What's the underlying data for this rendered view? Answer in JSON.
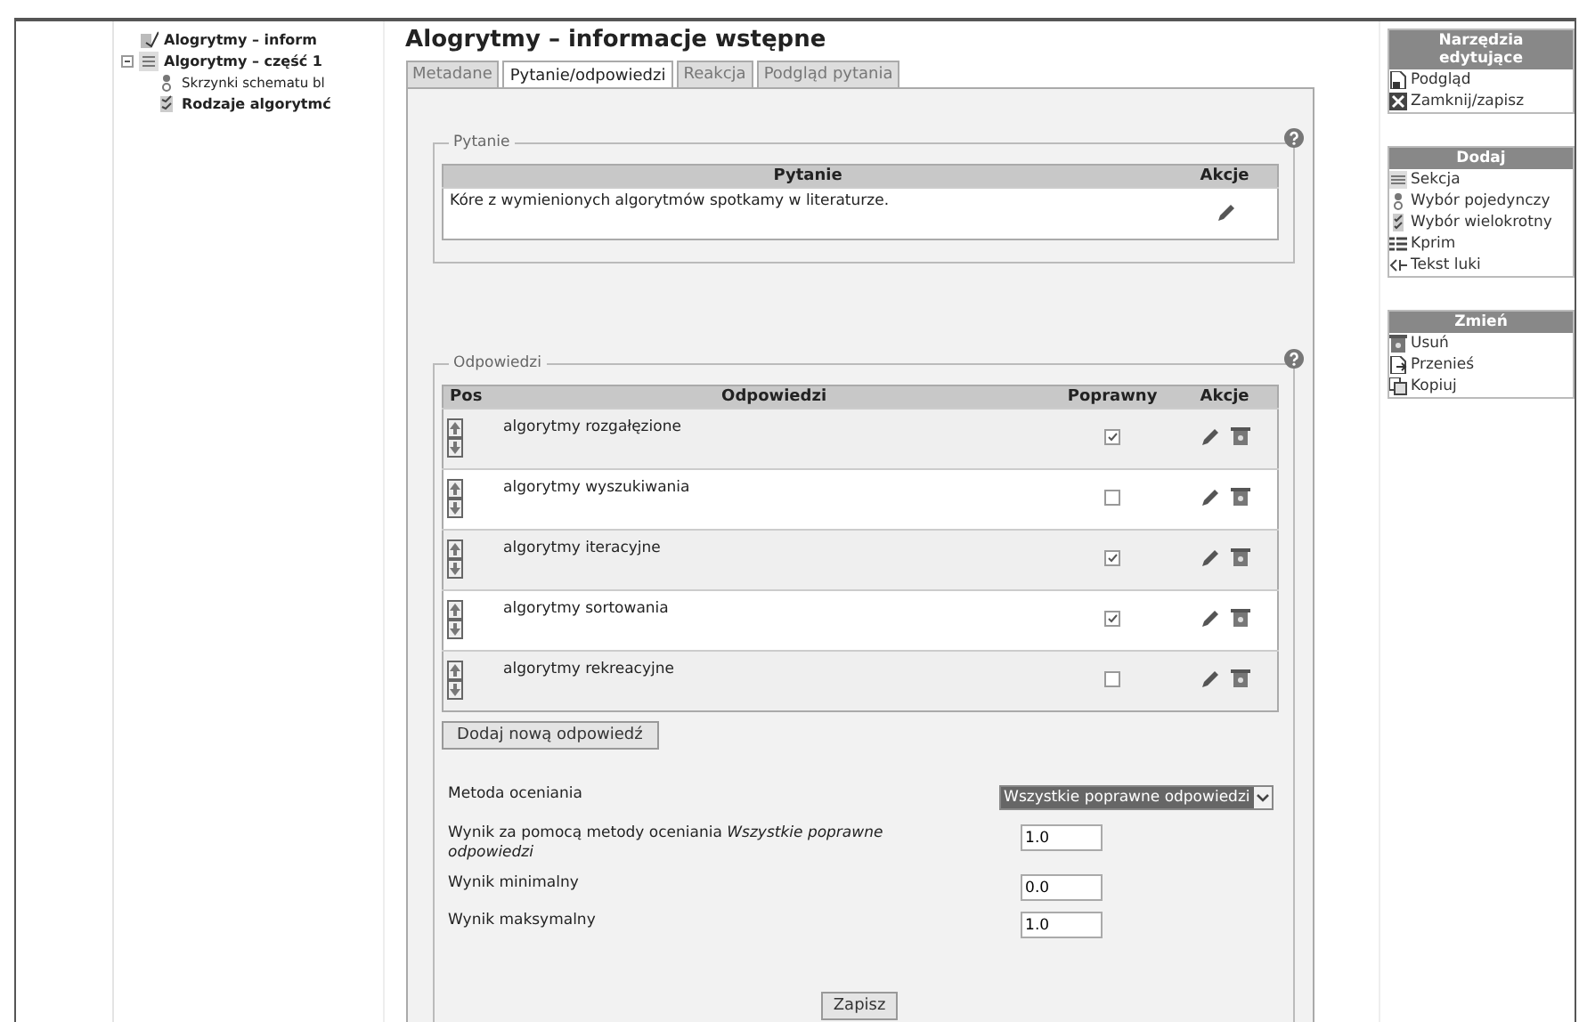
{
  "tree": [
    {
      "label": "Alogrytmy – inform",
      "kind": "quiz"
    },
    {
      "label": "Algorytmy – część 1",
      "kind": "section",
      "expanded": true,
      "children": [
        {
          "label": "Skrzynki schematu bl",
          "kind": "single",
          "selected": false
        },
        {
          "label": "Rodzaje algorytmć",
          "kind": "multiple",
          "selected": true
        }
      ]
    }
  ],
  "title": "Alogrytmy – informacje wstępne",
  "tabs": [
    {
      "label": "Metadane",
      "selected": false
    },
    {
      "label": "Pytanie/odpowiedzi",
      "selected": true
    },
    {
      "label": "Reakcja",
      "selected": false
    },
    {
      "label": "Podgląd pytania",
      "selected": false
    }
  ],
  "question": {
    "legend": "Pytanie",
    "columns": [
      "Pytanie",
      "Akcje"
    ],
    "text": "Kóre z wymienionych algorytmów spotkamy w literaturze."
  },
  "answers": {
    "legend": "Odpowiedzi",
    "columns": [
      "Pos",
      "Odpowiedzi",
      "Poprawny",
      "Akcje"
    ],
    "rows": [
      {
        "text": "algorytmy rozgałęzione",
        "correct": true
      },
      {
        "text": "algorytmy wyszukiwania",
        "correct": false
      },
      {
        "text": "algorytmy iteracyjne",
        "correct": true
      },
      {
        "text": "algorytmy sortowania",
        "correct": true
      },
      {
        "text": "algorytmy rekreacyjne",
        "correct": false
      }
    ],
    "add_button": "Dodaj nową odpowiedź"
  },
  "grading": {
    "method_label": "Metoda oceniania",
    "method_value": "Wszystkie poprawne odpowiedzi",
    "fields": [
      {
        "label": "Wynik za pomocą metody oceniania *Wszystkie poprawne odpowiedzi*",
        "value": "1.0"
      },
      {
        "label": "Wynik minimalny",
        "value": "0.0"
      },
      {
        "label": "Wynik maksymalny",
        "value": "1.0"
      }
    ]
  },
  "save_button": "Zapisz",
  "side_panels": [
    {
      "title": "Narzędzia edytujące",
      "items": [
        {
          "label": "Podgląd",
          "kind": "preview"
        },
        {
          "label": "Zamknij/zapisz",
          "kind": "close"
        }
      ]
    },
    {
      "title": "Dodaj",
      "items": [
        {
          "label": "Sekcja",
          "kind": "section"
        },
        {
          "label": "Wybór pojedynczy",
          "kind": "single"
        },
        {
          "label": "Wybór wielokrotny",
          "kind": "multiple"
        },
        {
          "label": "Kprim",
          "kind": "kprim"
        },
        {
          "label": "Tekst luki",
          "kind": "gap"
        }
      ]
    },
    {
      "title": "Zmień",
      "items": [
        {
          "label": "Usuń",
          "kind": "delete"
        },
        {
          "label": "Przenieś",
          "kind": "move"
        },
        {
          "label": "Kopiuj",
          "kind": "copy"
        }
      ]
    }
  ]
}
